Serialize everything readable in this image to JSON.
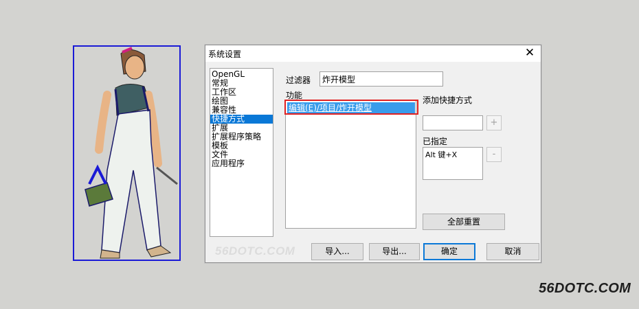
{
  "background_color": "#d3d3d0",
  "accent_color": "#0a78d7",
  "highlight_color": "#e02020",
  "selection_box_color": "#1a1ad6",
  "figure": {
    "icon": "worker-with-toolbox-icon"
  },
  "dialog": {
    "title": "系统设置",
    "close_label": "✕",
    "categories": [
      "OpenGL",
      "常规",
      "工作区",
      "绘图",
      "兼容性",
      "快捷方式",
      "扩展",
      "扩展程序策略",
      "模板",
      "文件",
      "应用程序"
    ],
    "selected_category": "快捷方式",
    "filter": {
      "label": "过滤器",
      "value": "炸开模型"
    },
    "function": {
      "label": "功能",
      "items": [
        "编辑(E)/项目/炸开模型"
      ]
    },
    "add_shortcut": {
      "label": "添加快捷方式",
      "value": "",
      "plus_label": "+"
    },
    "assigned": {
      "label": "已指定",
      "items": [
        "Alt 键+X"
      ],
      "minus_label": "-"
    },
    "reset_all": "全部重置",
    "buttons": {
      "import": "导入...",
      "export": "导出...",
      "ok": "确定",
      "cancel": "取消"
    },
    "watermark": "56DOTC.COM"
  },
  "site_watermark": "56DOTC.COM"
}
